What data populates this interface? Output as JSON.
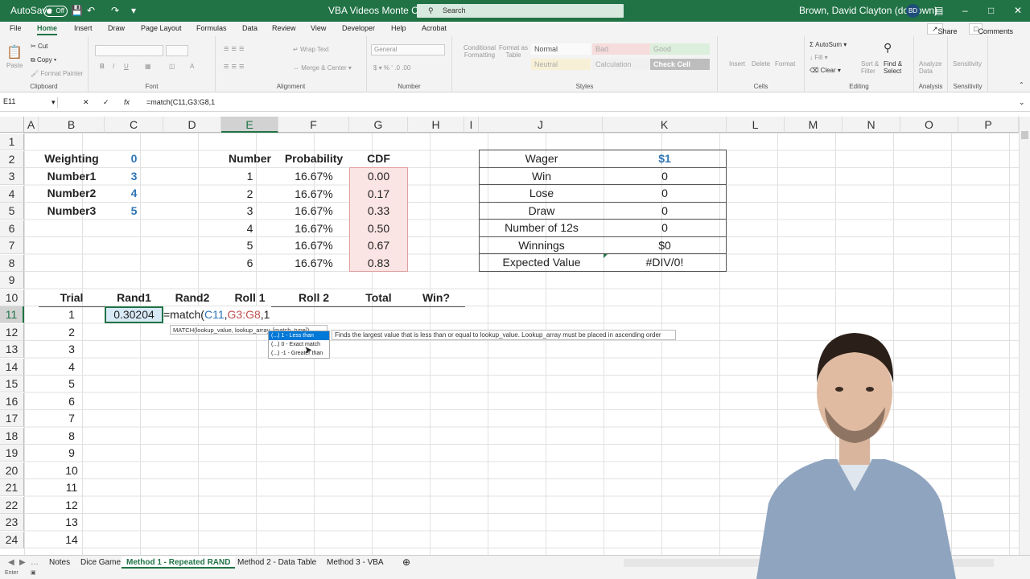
{
  "title": {
    "autosave": "AutoSave",
    "autosave_state": "Off",
    "doc_name": "VBA Videos Monte Carlo",
    "search_placeholder": "Search",
    "user": "Brown, David Clayton (dcbrown)",
    "initials": "BD"
  },
  "menu": {
    "tabs": [
      "File",
      "Home",
      "Insert",
      "Draw",
      "Page Layout",
      "Formulas",
      "Data",
      "Review",
      "View",
      "Developer",
      "Help",
      "Acrobat"
    ],
    "share": "Share",
    "comments": "Comments"
  },
  "ribbon": {
    "clipboard": {
      "cut": "Cut",
      "copy": "Copy",
      "painter": "Format Painter",
      "paste": "Paste",
      "label": "Clipboard"
    },
    "font_label": "Font",
    "alignment": {
      "wrap": "Wrap Text",
      "merge": "Merge & Center",
      "label": "Alignment"
    },
    "number": {
      "format": "General",
      "label": "Number"
    },
    "styles": {
      "cond": "Conditional Formatting",
      "table": "Format as Table",
      "normal": "Normal",
      "bad": "Bad",
      "good": "Good",
      "neutral": "Neutral",
      "calc": "Calculation",
      "check": "Check Cell",
      "label": "Styles"
    },
    "cells": {
      "insert": "Insert",
      "delete": "Delete",
      "format": "Format",
      "label": "Cells"
    },
    "editing": {
      "autosum": "AutoSum",
      "fill": "Fill",
      "clear": "Clear",
      "sort": "Sort & Filter",
      "find": "Find & Select",
      "label": "Editing"
    },
    "analysis": {
      "analyze": "Analyze Data",
      "label": "Analysis"
    },
    "sensitivity": {
      "btn": "Sensitivity",
      "label": "Sensitivity"
    }
  },
  "formula_bar": {
    "namebox": "E11",
    "content": "=match(C11,G3:G8,1"
  },
  "columns": [
    "A",
    "B",
    "C",
    "D",
    "E",
    "F",
    "G",
    "H",
    "I",
    "J",
    "K",
    "L",
    "M",
    "N",
    "O",
    "P"
  ],
  "rows": [
    "1",
    "2",
    "3",
    "4",
    "5",
    "6",
    "7",
    "8",
    "9",
    "10",
    "11",
    "12",
    "13",
    "14",
    "15",
    "16",
    "17",
    "18",
    "19",
    "20",
    "21",
    "22",
    "23",
    "24"
  ],
  "weights": {
    "labels": [
      "Weighting",
      "Number1",
      "Number2",
      "Number3"
    ],
    "values": [
      "0",
      "3",
      "4",
      "5"
    ]
  },
  "dist": {
    "headers": [
      "Number",
      "Probability",
      "CDF"
    ],
    "numbers": [
      "1",
      "2",
      "3",
      "4",
      "5",
      "6"
    ],
    "probs": [
      "16.67%",
      "16.67%",
      "16.67%",
      "16.67%",
      "16.67%",
      "16.67%"
    ],
    "cdf": [
      "0.00",
      "0.17",
      "0.33",
      "0.50",
      "0.67",
      "0.83"
    ]
  },
  "summary": {
    "labels": [
      "Wager",
      "Win",
      "Lose",
      "Draw",
      "Number of 12s",
      "Winnings",
      "Expected Value"
    ],
    "values": [
      "$1",
      "0",
      "0",
      "0",
      "0",
      "$0",
      "#DIV/0!"
    ]
  },
  "trial_table": {
    "headers": [
      "Trial",
      "Rand1",
      "Rand2",
      "Roll 1",
      "Roll 2",
      "Total",
      "Win?"
    ],
    "trials": [
      "1",
      "2",
      "3",
      "4",
      "5",
      "6",
      "7",
      "8",
      "9",
      "10",
      "11",
      "12",
      "13",
      "14"
    ],
    "rand1_first": "0.30204",
    "editing_formula": {
      "prefix": "=match(",
      "ref1": "C11",
      "sep1": ",",
      "ref2": "G3:G8",
      "suffix": ",1"
    }
  },
  "autocomplete": {
    "signature": "MATCH(lookup_value, lookup_array, [match_type])",
    "description": "Finds the largest value that is less than or equal to lookup_value. Lookup_array must be placed in ascending order",
    "options": [
      "(...) 1 - Less than",
      "(...) 0 - Exact match",
      "(...) -1 - Greater than"
    ]
  },
  "sheets": [
    "Notes",
    "Dice Game",
    "Method 1 - Repeated RAND",
    "Method 2 - Data Table",
    "Method 3 - VBA"
  ],
  "status": {
    "mode": "Enter"
  }
}
